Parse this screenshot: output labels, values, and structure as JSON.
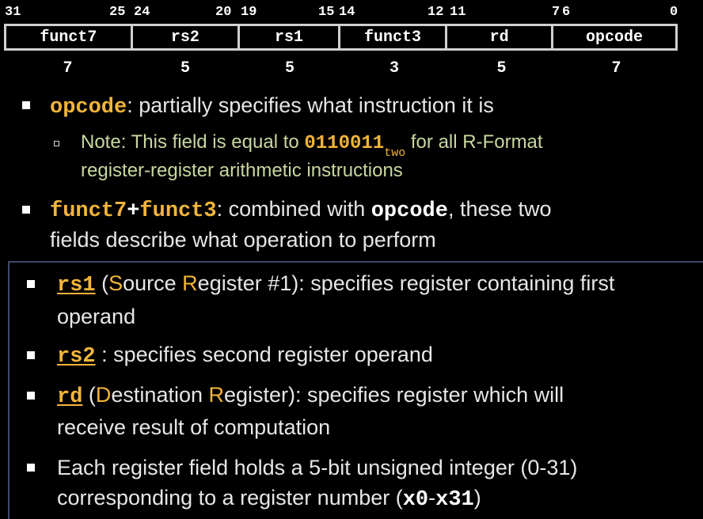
{
  "format": {
    "bit_positions": [
      "31",
      "25",
      "24",
      "20",
      "19",
      "15",
      "14",
      "12",
      "11",
      "7",
      "6",
      "0"
    ],
    "fields": [
      {
        "name": "funct7",
        "width": "7"
      },
      {
        "name": "rs2",
        "width": "5"
      },
      {
        "name": "rs1",
        "width": "5"
      },
      {
        "name": "funct3",
        "width": "3"
      },
      {
        "name": "rd",
        "width": "5"
      },
      {
        "name": "opcode",
        "width": "7"
      }
    ]
  },
  "bullets": {
    "opcode": {
      "term": "opcode",
      "text": ": partially specifies what instruction it is",
      "note_prefix": "Note: This field is equal to ",
      "note_value": "0110011",
      "note_sub": "two",
      "note_suffix": " for all R-Format",
      "note_line2": "register-register arithmetic instructions"
    },
    "funct": {
      "term1": "funct7",
      "plus": "+",
      "term2": "funct3",
      "text1": ": combined with ",
      "term3": "opcode",
      "text2": ", these two",
      "line2": "fields describe what operation to perform"
    },
    "rs1": {
      "term": "rs1",
      "text_a": " (",
      "s_letter": "S",
      "text_b": "ource ",
      "r_letter": "R",
      "text_c": "egister #1): specifies register containing first",
      "line2": "operand"
    },
    "rs2": {
      "term": "rs2",
      "text": " : specifies second register operand"
    },
    "rd": {
      "term": "rd",
      "text_a": " (",
      "d_letter": "D",
      "text_b": "estination ",
      "r_letter": "R",
      "text_c": "egister): specifies register which will",
      "line2": "receive result of computation"
    },
    "each": {
      "line1": "Each register field holds a 5-bit unsigned integer (0-31)",
      "line2_prefix": "corresponding to a register number (",
      "x0": "x0",
      "dash": "-",
      "x31": "x31",
      "close": ")"
    }
  }
}
